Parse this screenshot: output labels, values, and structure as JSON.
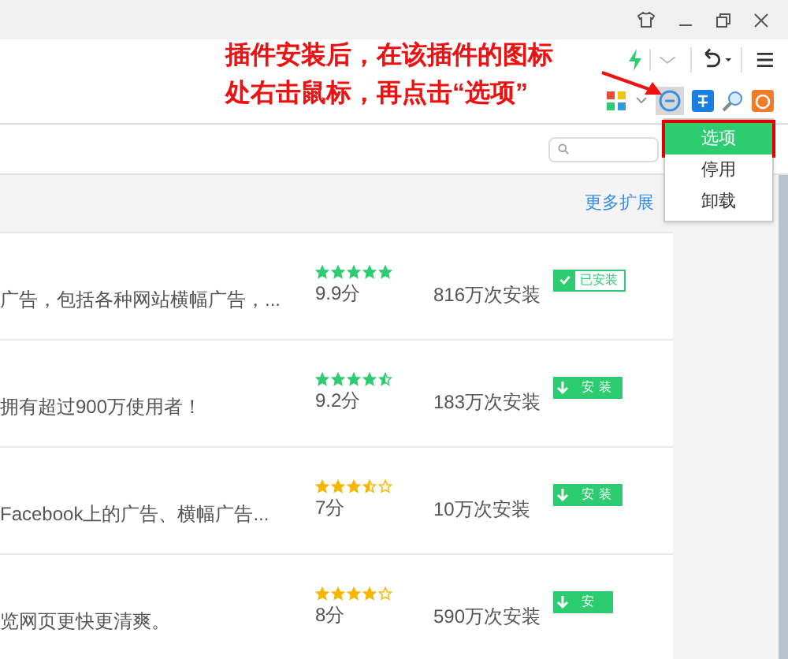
{
  "annotation": {
    "lines": [
      "插件安装后，在该插件的图标",
      "处右击鼠标，再点击“选项”"
    ]
  },
  "context_menu": {
    "items": [
      {
        "label": "选项",
        "selected": true
      },
      {
        "label": "停用",
        "selected": false
      },
      {
        "label": "卸载",
        "selected": false
      }
    ]
  },
  "more_link": "更多扩展",
  "extensions": [
    {
      "description": "广告，包括各种网站横幅广告，...",
      "stars": 5,
      "color": "#2ecc71",
      "score": "9.9分",
      "installs": "816万次安装",
      "button": {
        "kind": "installed",
        "label": "已安装"
      }
    },
    {
      "description": "拥有超过900万使用者！",
      "stars": 4.5,
      "color": "#2ecc71",
      "score": "9.2分",
      "installs": "183万次安装",
      "button": {
        "kind": "install",
        "label": "安装"
      }
    },
    {
      "description": "Facebook上的广告、横幅广告...",
      "stars": 3.5,
      "color": "#f5b700",
      "score": "7分",
      "installs": "10万次安装",
      "button": {
        "kind": "install",
        "label": "安装"
      }
    },
    {
      "description": "览网页更快更清爽。",
      "stars": 4,
      "color": "#f5b700",
      "score": "8分",
      "installs": "590万次安装",
      "button": {
        "kind": "install",
        "label": "安"
      }
    }
  ]
}
